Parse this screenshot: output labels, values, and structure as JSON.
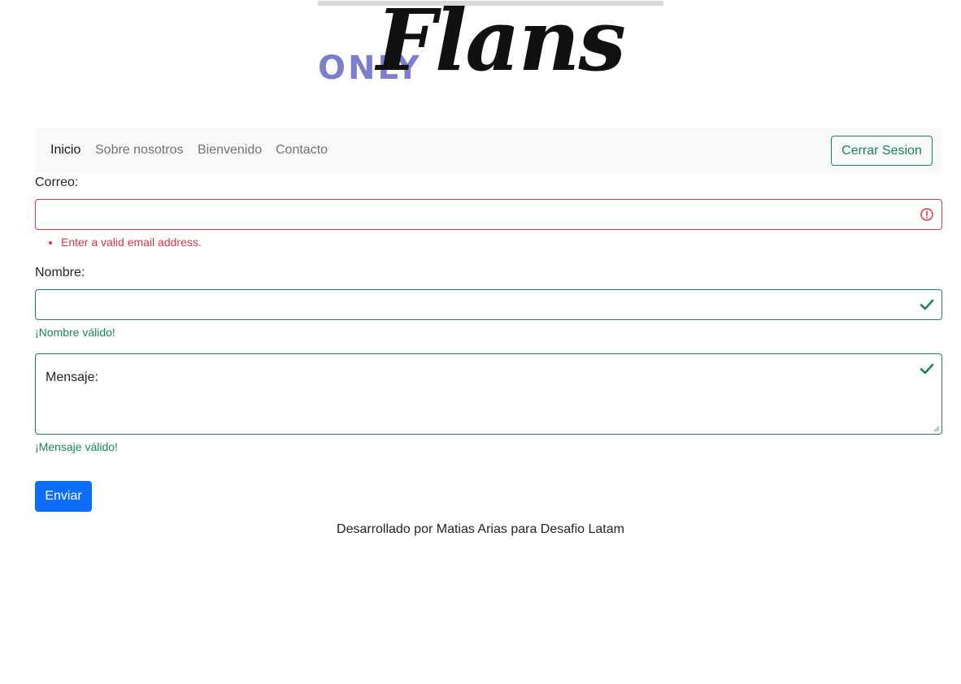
{
  "logo": {
    "prefix": "ONLY",
    "script": "Flans"
  },
  "nav": {
    "items": [
      {
        "label": "Inicio",
        "active": true
      },
      {
        "label": "Sobre nosotros",
        "active": false
      },
      {
        "label": "Bienvenido",
        "active": false
      },
      {
        "label": "Contacto",
        "active": false
      }
    ],
    "logout_label": "Cerrar Sesion"
  },
  "form": {
    "email": {
      "label": "Correo:",
      "value": "",
      "error": "Enter a valid email address."
    },
    "name": {
      "label": "Nombre:",
      "value": "",
      "valid_msg": "¡Nombre válido!"
    },
    "message": {
      "placeholder": "Mensaje:",
      "value": "",
      "valid_msg": "¡Mensaje válido!"
    },
    "submit_label": "Enviar"
  },
  "footer": {
    "text": "Desarrollado por Matias Arias para Desafio Latam"
  },
  "colors": {
    "valid": "#198754",
    "invalid": "#dc3545",
    "primary": "#0d6efd",
    "logo_purple": "#7b7fce"
  },
  "icons": {
    "invalid": "exclamation-circle-icon",
    "valid": "check-icon"
  }
}
